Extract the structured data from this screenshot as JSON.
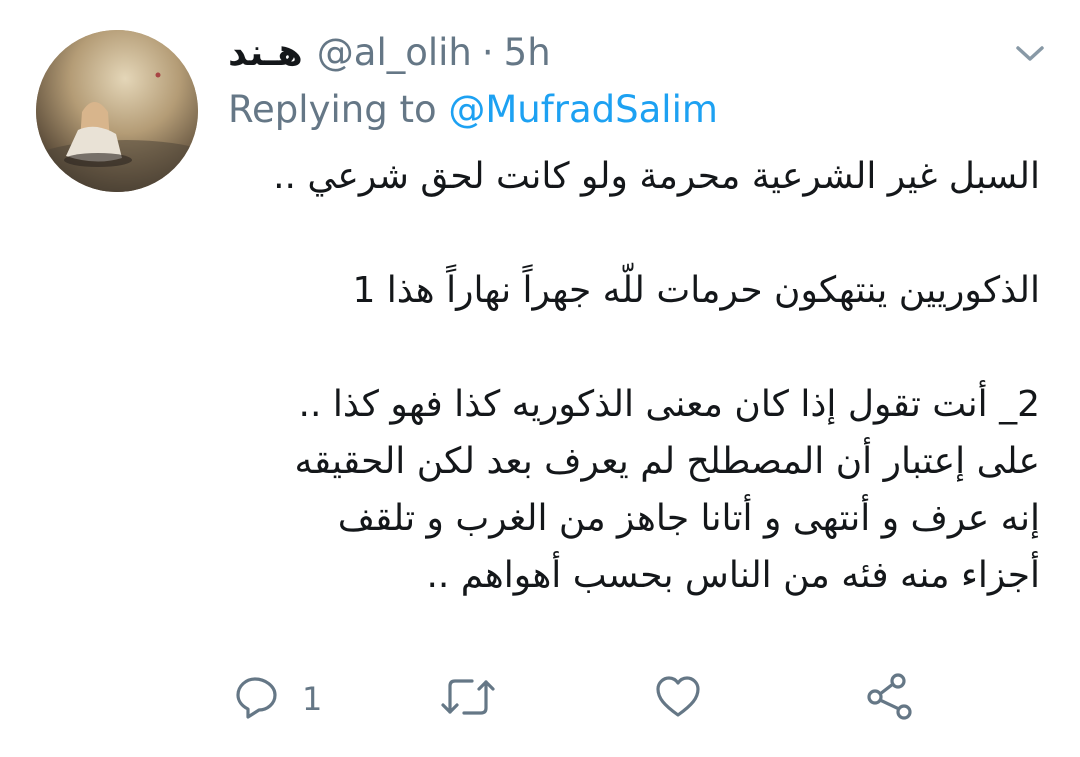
{
  "tweet": {
    "display_name": "هـند",
    "handle": "@al_olih",
    "separator": "·",
    "time": "5h",
    "replying_prefix": "Replying to",
    "replying_to": "@MufradSalim",
    "body_lines": [
      "السبل غير الشرعية محرمة ولو كانت لحق شرعي ..",
      "",
      "الذكوريين ينتهكون حرمات للّه جهراً نهاراً هذا 1",
      "",
      "2_ أنت تقول إذا كان معنى الذكوريه كذا فهو كذا ..",
      "على إعتبار أن المصطلح لم يعرف بعد  لكن الحقيقه",
      "إنه عرف و أنتهى و أتانا جاهز من الغرب و تلقف",
      "أجزاء منه فئه من الناس بحسب أهواهم .."
    ],
    "reply_count": "1"
  },
  "icons": {
    "menu": "chevron-down-icon",
    "reply": "reply-icon",
    "retweet": "retweet-icon",
    "like": "heart-icon",
    "share": "share-icon"
  },
  "colors": {
    "text": "#14171a",
    "secondary": "#657786",
    "link": "#1da1f2",
    "icon": "#657786"
  }
}
